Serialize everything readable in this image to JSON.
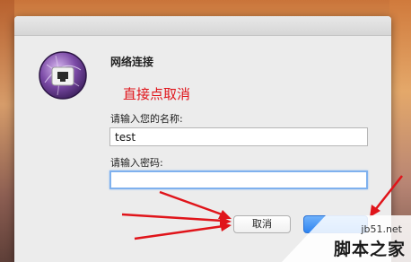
{
  "dialog": {
    "title": "网络连接",
    "name_label": "请输入您的名称:",
    "name_value": "test",
    "password_label": "请输入密码:",
    "password_value": "",
    "cancel_label": "取消",
    "ok_label": ""
  },
  "annotation": {
    "text": "直接点取消",
    "color": "#e0141a"
  },
  "watermark": {
    "url": "jb51.net",
    "name": "脚本之家"
  },
  "icons": {
    "app": "network-connection-icon"
  },
  "colors": {
    "accent_blue": "#2f84f0",
    "arrow_red": "#e0141a"
  }
}
